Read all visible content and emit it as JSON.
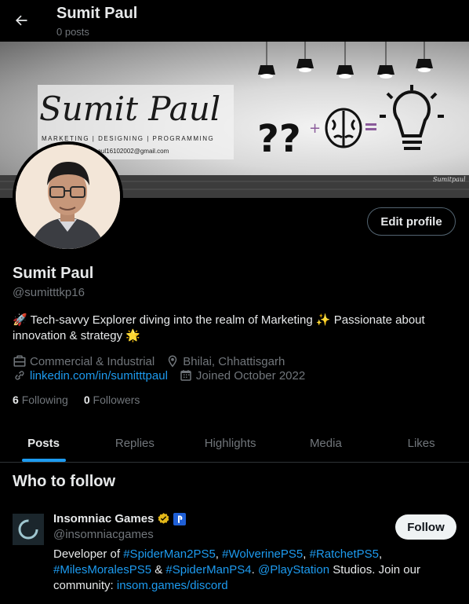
{
  "header": {
    "title": "Sumit Paul",
    "subtitle": "0 posts"
  },
  "banner": {
    "script_name": "Sumit Paul",
    "tagline": "MARKETING | DESIGNING | PROGRAMMING",
    "email": "paul16102002@gmail.com",
    "signature": "Sumitpaul"
  },
  "profile": {
    "name": "Sumit Paul",
    "handle": "@sumitttkp16",
    "bio_parts": [
      "🚀",
      " Tech-savvy Explorer diving into the realm of Marketing ",
      "✨",
      " Passionate about innovation & strategy ",
      "🌟"
    ],
    "edit_label": "Edit profile",
    "category": "Commercial & Industrial",
    "location": "Bhilai, Chhattisgarh",
    "website": "linkedin.com/in/sumitttpaul",
    "joined": "Joined October 2022",
    "following_count": "6",
    "following_label": "Following",
    "followers_count": "0",
    "followers_label": "Followers"
  },
  "tabs": [
    {
      "label": "Posts"
    },
    {
      "label": "Replies"
    },
    {
      "label": "Highlights"
    },
    {
      "label": "Media"
    },
    {
      "label": "Likes"
    }
  ],
  "who_to_follow": {
    "title": "Who to follow",
    "account": {
      "name": "Insomniac Games",
      "handle": "@insomniacgames",
      "follow_label": "Follow",
      "bio": {
        "t1": "Developer of ",
        "h1": "#SpiderMan2PS5",
        "t2": ", ",
        "h2": "#WolverinePS5",
        "t3": ", ",
        "h3": "#RatchetPS5",
        "t4": ", ",
        "h4": "#MilesMoralesPS5",
        "t5": " & ",
        "h5": "#SpiderManPS4",
        "t6": ". ",
        "m1": "@PlayStation",
        "t7": " Studios. Join our community: ",
        "l1": "insom.games/discord"
      }
    }
  },
  "colors": {
    "accent": "#1d9bf0",
    "background": "#000000",
    "muted": "#71767b",
    "verified_gold": "#e2b719"
  }
}
